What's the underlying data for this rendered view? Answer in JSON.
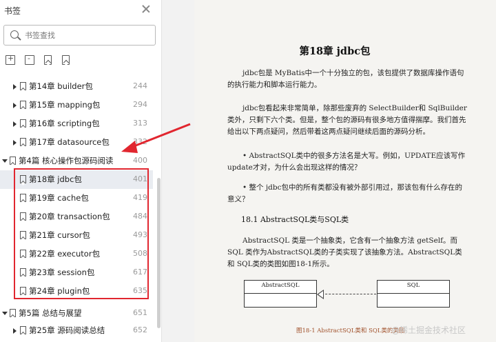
{
  "sidebar": {
    "title": "书签",
    "search_placeholder": "书签查找",
    "items": [
      {
        "label": "第14章 builder包",
        "page": "244",
        "level": 2,
        "expanded": false
      },
      {
        "label": "第15章 mapping包",
        "page": "294",
        "level": 2,
        "expanded": false
      },
      {
        "label": "第16章 scripting包",
        "page": "313",
        "level": 2,
        "expanded": false
      },
      {
        "label": "第17章 datasource包",
        "page": "332",
        "level": 2,
        "expanded": false
      },
      {
        "label": "第4篇 核心操作包源码阅读",
        "page": "400",
        "level": 1,
        "expanded": true
      },
      {
        "label": "第18章 jdbc包",
        "page": "401",
        "level": 2,
        "expanded": false,
        "selected": true
      },
      {
        "label": "第19章 cache包",
        "page": "419",
        "level": 2,
        "expanded": false
      },
      {
        "label": "第20章 transaction包",
        "page": "484",
        "level": 2,
        "expanded": false
      },
      {
        "label": "第21章 cursor包",
        "page": "493",
        "level": 2,
        "expanded": false
      },
      {
        "label": "第22章 executor包",
        "page": "508",
        "level": 2,
        "expanded": false
      },
      {
        "label": "第23章 session包",
        "page": "617",
        "level": 2,
        "expanded": false
      },
      {
        "label": "第24章 plugin包",
        "page": "635",
        "level": 2,
        "expanded": false
      },
      {
        "label": "第5篇 总结与展望",
        "page": "651",
        "level": 1,
        "expanded": true
      },
      {
        "label": "第25章 源码阅读总结",
        "page": "652",
        "level": 2,
        "expanded": false
      }
    ]
  },
  "document": {
    "chapter_title": "第18章 jdbc包",
    "para1": "jdbc包是 MyBatis中一个十分独立的包，该包提供了数据库操作语句的执行能力和脚本运行能力。",
    "para2": "jdbc包看起来非常简单，除那些废弃的 SelectBuilder和 SqlBuilder类外，只剩下六个类。但是，整个包的源码有很多地方值得揣摩。我们首先给出以下两点疑问，然后带着这两点疑问继续后面的源码分析。",
    "bullet1": "AbstractSQL类中的很多方法名是大写。例如，UPDATE应该写作update才对，为什么会出现这样的情况？",
    "bullet2": "整个 jdbc包中的所有类都没有被外部引用过，那该包有什么存在的意义？",
    "section_heading": "18.1 AbstractSQL类与SQL类",
    "para3": "AbstractSQL 类是一个抽象类，它含有一个抽象方法 getSelf。而 SQL 类作为AbstractSQL类的子类实现了该抽象方法。AbstractSQL类和 SQL类的类图如图18-1所示。",
    "uml_left": "AbstractSQL",
    "uml_right": "SQL",
    "fig_caption": "图18-1 AbstractSQL类和 SQL类的类图",
    "watermark": "@稀土掘金技术社区"
  },
  "colors": {
    "highlight": "#e1262f",
    "selected_row": "#e9ecf1"
  }
}
